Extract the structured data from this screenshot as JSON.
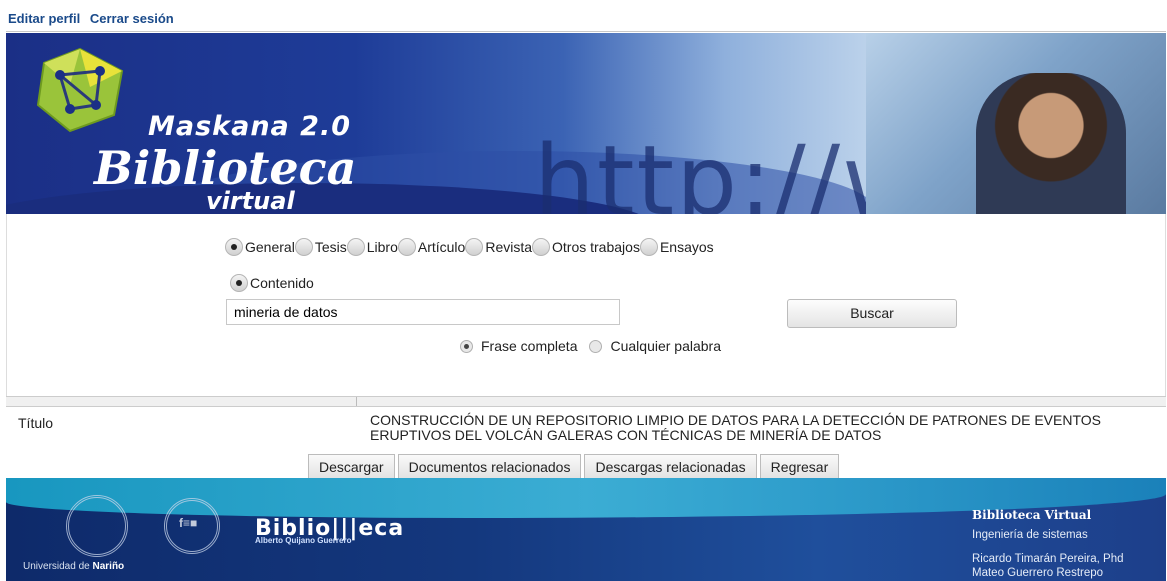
{
  "toplinks": {
    "edit_profile": "Editar perfil",
    "logout": "Cerrar sesión"
  },
  "banner": {
    "title_top": "Maskana 2.0",
    "title_main": "Biblioteca",
    "title_sub": "virtual",
    "bg_text": "http://w"
  },
  "search": {
    "types": [
      {
        "label": "General",
        "selected": true
      },
      {
        "label": "Tesis",
        "selected": false
      },
      {
        "label": "Libro",
        "selected": false
      },
      {
        "label": "Artículo",
        "selected": false
      },
      {
        "label": "Revista",
        "selected": false
      },
      {
        "label": "Otros trabajos",
        "selected": false
      },
      {
        "label": "Ensayos",
        "selected": false
      }
    ],
    "scope_label": "Contenido",
    "query_value": "mineria de datos",
    "search_button": "Buscar",
    "mode_full": "Frase completa",
    "mode_any": "Cualquier palabra"
  },
  "result": {
    "label": "Título",
    "value": "CONSTRUCCIÓN DE UN REPOSITORIO LIMPIO DE DATOS PARA LA DETECCIÓN DE PATRONES DE EVENTOS ERUPTIVOS DEL VOLCÁN GALERAS CON TÉCNICAS DE MINERÍA DE DATOS"
  },
  "actions": {
    "download": "Descargar",
    "related_docs": "Documentos relacionados",
    "related_downloads": "Descargas relacionadas",
    "back": "Regresar"
  },
  "footer": {
    "university": "Universidad de",
    "university_bold": "Nariño",
    "library_name": "Biblio|||eca",
    "library_sub": "Alberto Quijano Guerrero",
    "right_title": "Biblioteca Virtual",
    "right_dept": "Ingeniería de sistemas",
    "author1": "Ricardo Timarán Pereira, Phd",
    "author2": "Mateo Guerrero Restrepo"
  }
}
